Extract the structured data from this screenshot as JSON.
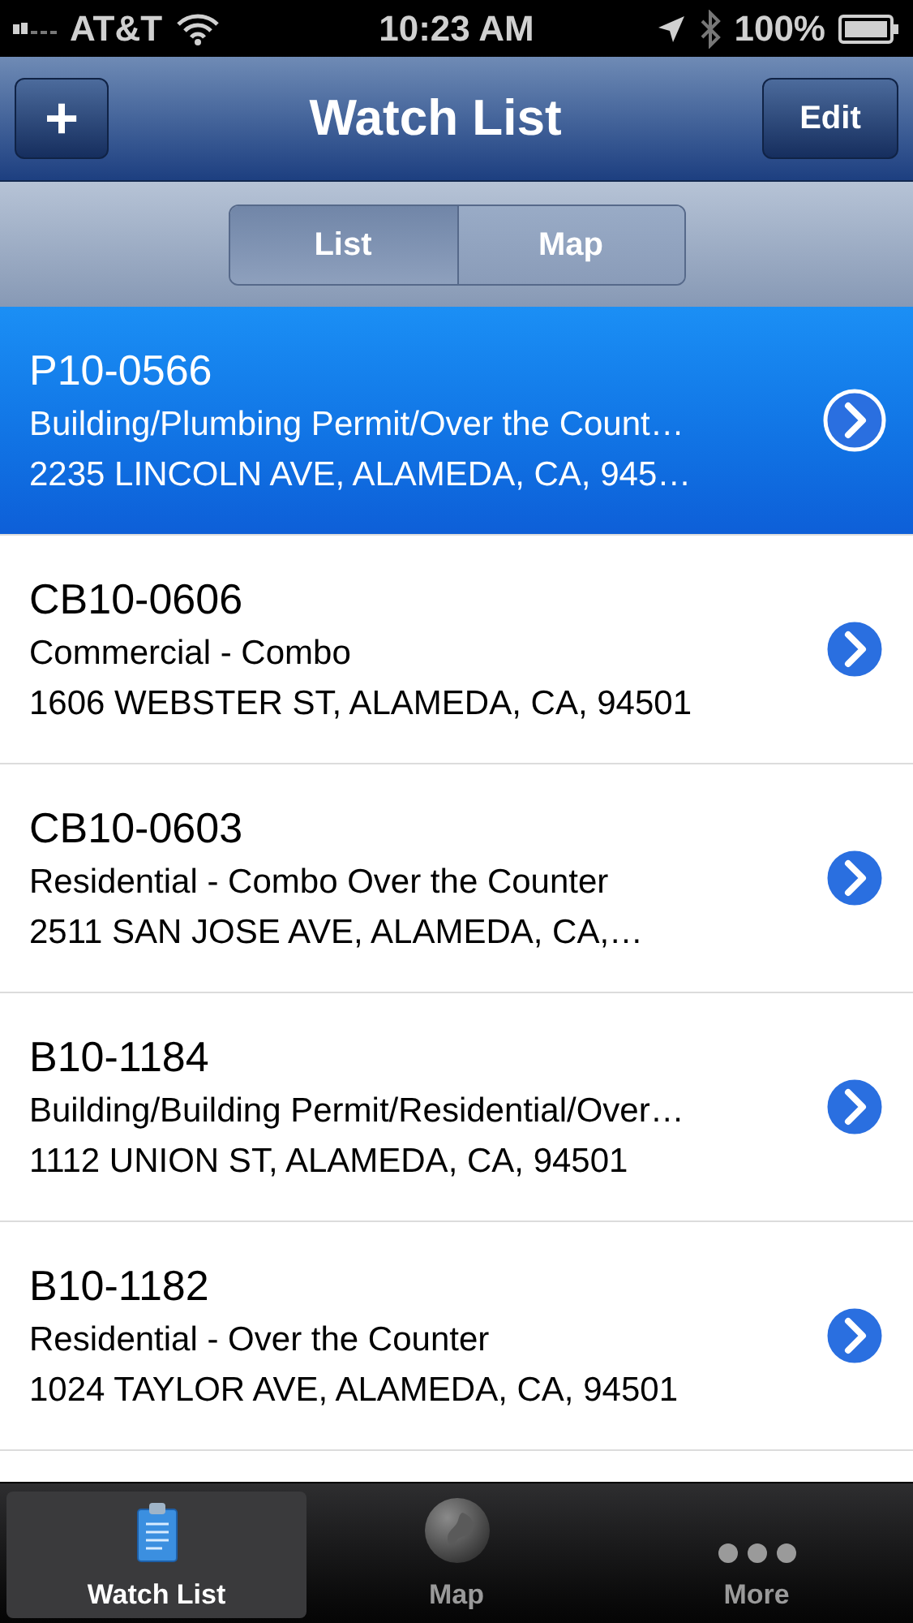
{
  "status_bar": {
    "carrier": "AT&T",
    "time": "10:23 AM",
    "battery": "100%"
  },
  "nav_bar": {
    "left_button": "+",
    "title": "Watch List",
    "right_button": "Edit"
  },
  "segments": [
    {
      "label": "List",
      "selected": true
    },
    {
      "label": "Map",
      "selected": false
    }
  ],
  "rows": [
    {
      "id": "P10-0566",
      "type": "Building/Plumbing Permit/Over the Count…",
      "address": "2235 LINCOLN AVE, ALAMEDA, CA, 945…",
      "selected": true
    },
    {
      "id": "CB10-0606",
      "type": "Commercial - Combo",
      "address": "1606 WEBSTER ST, ALAMEDA, CA, 94501",
      "selected": false
    },
    {
      "id": "CB10-0603",
      "type": "Residential - Combo Over the Counter",
      "address": "2511 SAN JOSE AVE, ALAMEDA, CA,…",
      "selected": false
    },
    {
      "id": "B10-1184",
      "type": "Building/Building Permit/Residential/Over…",
      "address": "1112 UNION ST, ALAMEDA, CA, 94501",
      "selected": false
    },
    {
      "id": "B10-1182",
      "type": "Residential - Over the Counter",
      "address": "1024 TAYLOR AVE, ALAMEDA, CA, 94501",
      "selected": false
    }
  ],
  "tab_bar": [
    {
      "kind": "clipboard",
      "label": "Watch List",
      "selected": true
    },
    {
      "kind": "globe",
      "label": "Map",
      "selected": false
    },
    {
      "kind": "dots",
      "label": "More",
      "selected": false
    }
  ]
}
